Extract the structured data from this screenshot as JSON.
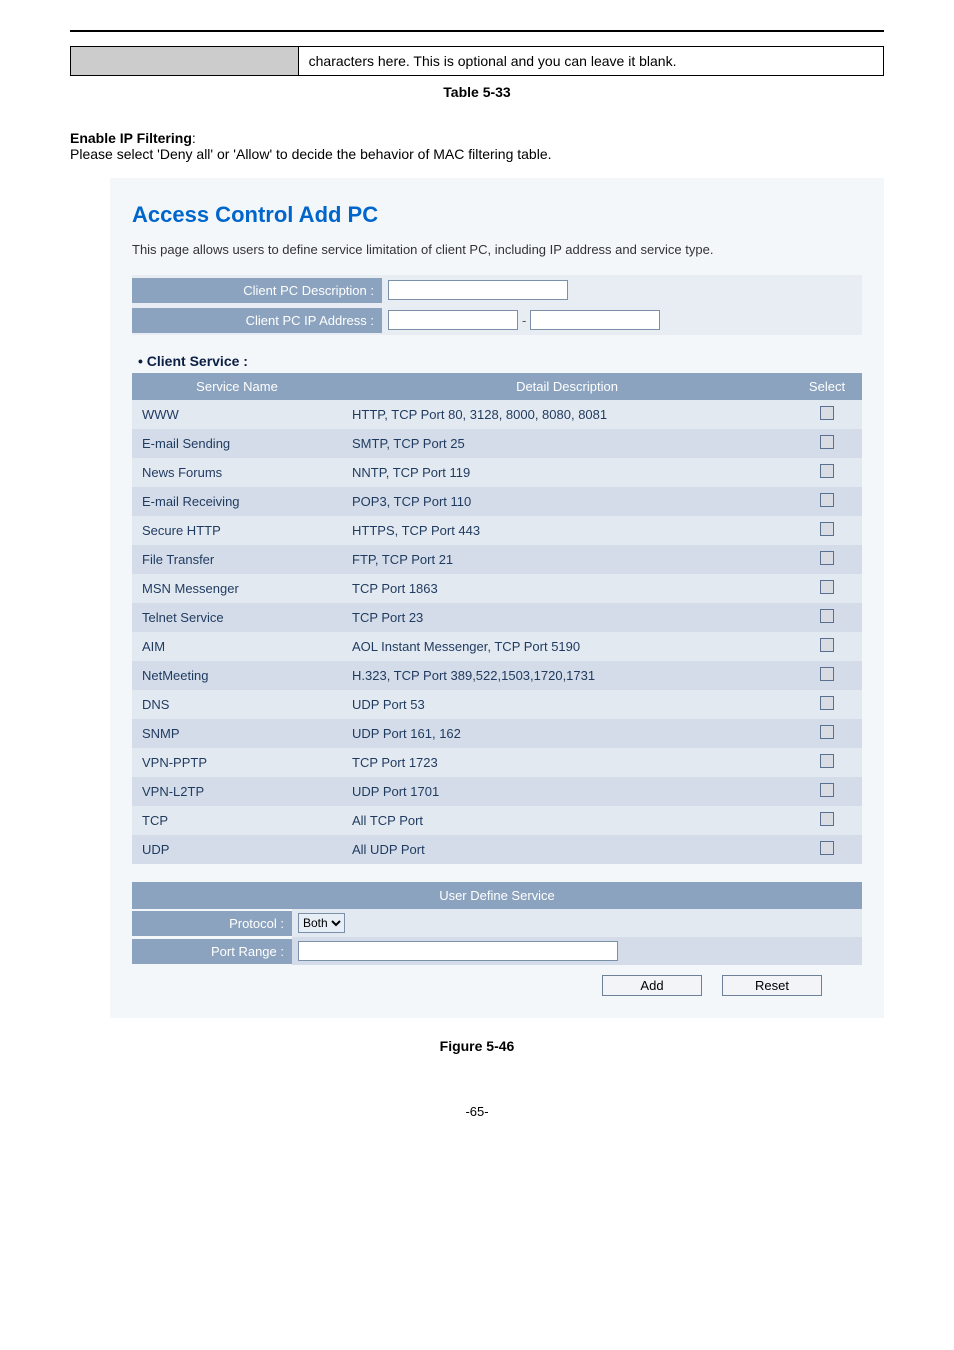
{
  "top_row_text": "characters here. This is optional and you can leave it blank.",
  "table_label": "Table 5-33",
  "filtering_heading": "Enable IP Filtering",
  "filtering_text": "Please select 'Deny all' or 'Allow' to decide the behavior of MAC filtering table.",
  "panel": {
    "title": "Access Control Add PC",
    "desc": "This page allows users to define service limitation of client PC, including IP address and service type.",
    "desc_label": "Client PC Description :",
    "ip_label": "Client PC IP Address :",
    "dash": "-",
    "client_service_heading": "Client Service :",
    "headers": {
      "name": "Service Name",
      "detail": "Detail Description",
      "select": "Select"
    },
    "services": [
      {
        "name": "WWW",
        "detail": "HTTP, TCP Port 80, 3128, 8000, 8080, 8081"
      },
      {
        "name": "E-mail Sending",
        "detail": "SMTP, TCP Port 25"
      },
      {
        "name": "News Forums",
        "detail": "NNTP, TCP Port 119"
      },
      {
        "name": "E-mail Receiving",
        "detail": "POP3, TCP Port 110"
      },
      {
        "name": "Secure HTTP",
        "detail": "HTTPS, TCP Port 443"
      },
      {
        "name": "File Transfer",
        "detail": "FTP, TCP Port 21"
      },
      {
        "name": "MSN Messenger",
        "detail": "TCP Port 1863"
      },
      {
        "name": "Telnet Service",
        "detail": "TCP Port 23"
      },
      {
        "name": "AIM",
        "detail": "AOL Instant Messenger, TCP Port 5190"
      },
      {
        "name": "NetMeeting",
        "detail": "H.323, TCP Port 389,522,1503,1720,1731"
      },
      {
        "name": "DNS",
        "detail": "UDP Port 53"
      },
      {
        "name": "SNMP",
        "detail": "UDP Port 161, 162"
      },
      {
        "name": "VPN-PPTP",
        "detail": "TCP Port 1723"
      },
      {
        "name": "VPN-L2TP",
        "detail": "UDP Port 1701"
      },
      {
        "name": "TCP",
        "detail": "All TCP Port"
      },
      {
        "name": "UDP",
        "detail": "All UDP Port"
      }
    ],
    "user_def_title": "User Define Service",
    "protocol_label": "Protocol :",
    "protocol_value": "Both",
    "port_range_label": "Port Range :",
    "add_btn": "Add",
    "reset_btn": "Reset"
  },
  "figure_label": "Figure 5-46",
  "page_num": "-65-"
}
